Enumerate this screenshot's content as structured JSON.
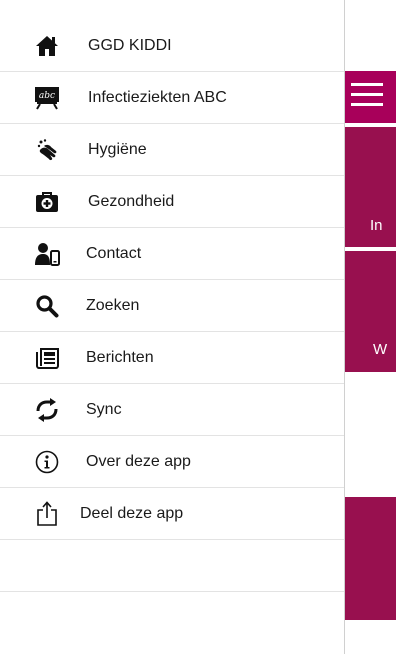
{
  "menu": {
    "items": [
      {
        "label": "GGD KIDDI",
        "icon": "home-icon"
      },
      {
        "label": "Infectieziekten ABC",
        "icon": "chalkboard-abc-icon"
      },
      {
        "label": "Hygiëne",
        "icon": "handwash-icon"
      },
      {
        "label": "Gezondheid",
        "icon": "first-aid-kit-icon"
      },
      {
        "label": "Contact",
        "icon": "contact-person-phone-icon"
      },
      {
        "label": "Zoeken",
        "icon": "search-icon"
      },
      {
        "label": "Berichten",
        "icon": "newspaper-icon"
      },
      {
        "label": "Sync",
        "icon": "sync-icon"
      },
      {
        "label": "Over deze app",
        "icon": "info-icon"
      },
      {
        "label": "Deel deze app",
        "icon": "share-icon"
      }
    ]
  },
  "background": {
    "tile1_label": "In",
    "tile2_label": "W",
    "menu_icon": "hamburger-icon"
  },
  "colors": {
    "accent": "#a8005a",
    "tile": "#98104f"
  }
}
